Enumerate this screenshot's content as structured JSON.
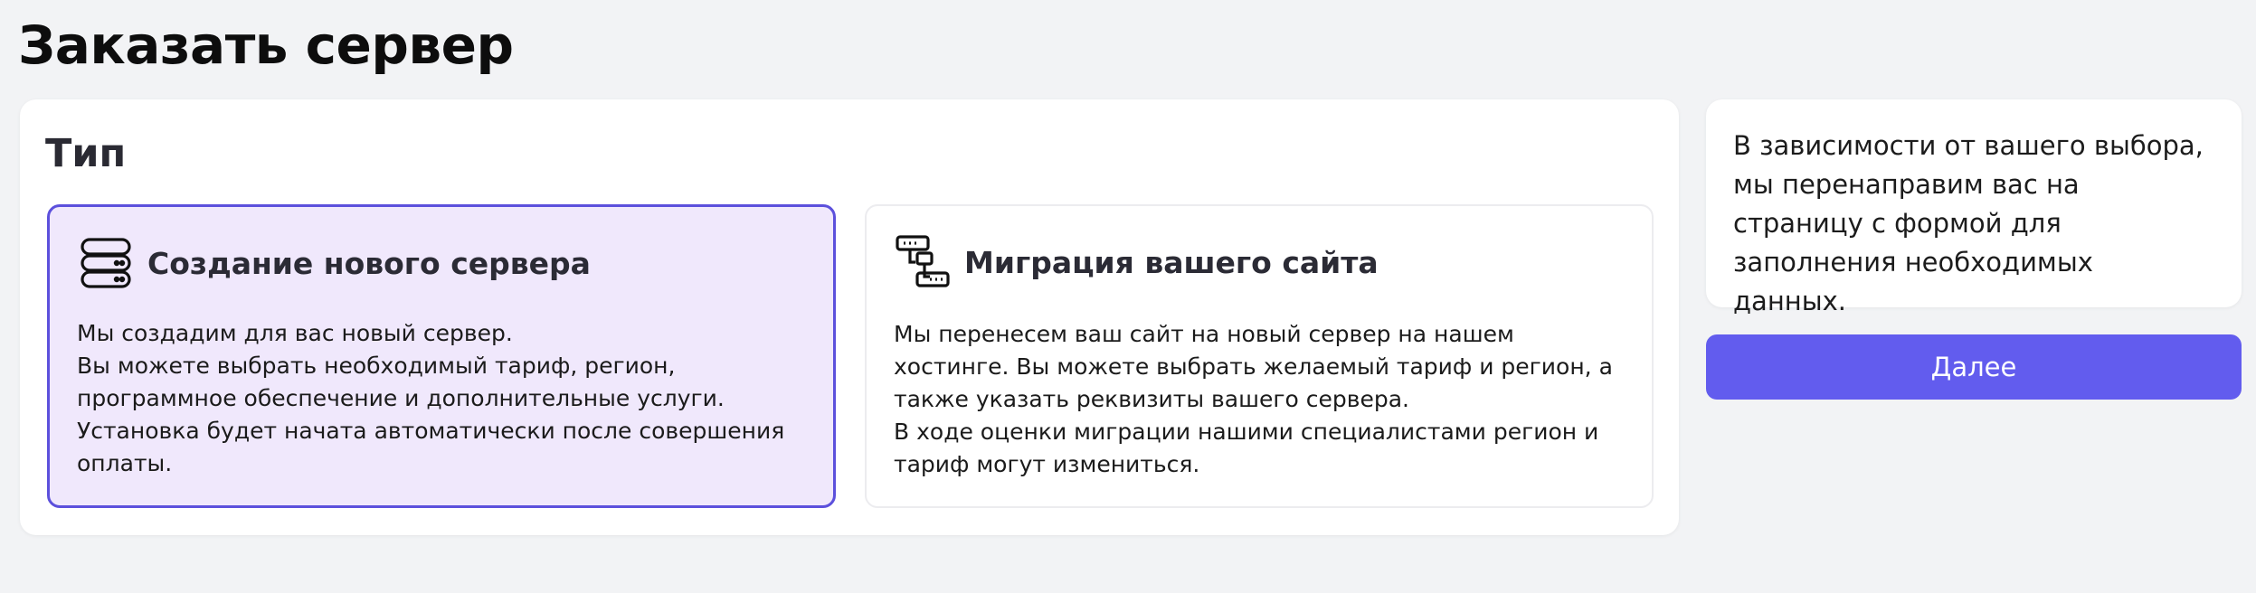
{
  "page": {
    "title": "Заказать сервер"
  },
  "type_section": {
    "title": "Тип",
    "options": [
      {
        "title": "Создание нового сервера",
        "icon": "server-stack-icon",
        "description": "Мы создадим для вас новый сервер.\nВы можете выбрать необходимый тариф, регион, программное обеспечение и дополнительные услуги. Установка будет начата автоматически после совершения оплаты.",
        "selected": true
      },
      {
        "title": "Миграция вашего сайта",
        "icon": "migration-icon",
        "description": "Мы перенесем ваш сайт на новый сервер на нашем хостинге. Вы можете выбрать желаемый тариф и регион, а также указать реквизиты вашего сервера.\nВ ходе оценки миграции нашими специалистами регион и тариф могут измениться.",
        "selected": false
      }
    ]
  },
  "info": {
    "text": "В зависимости от вашего выбора, мы перенаправим вас на страницу с формой для заполнения необходимых данных."
  },
  "actions": {
    "next_label": "Далее"
  },
  "colors": {
    "accent": "#625cee",
    "selected_bg": "#f0e8fc",
    "selected_border": "#5c50dc"
  }
}
